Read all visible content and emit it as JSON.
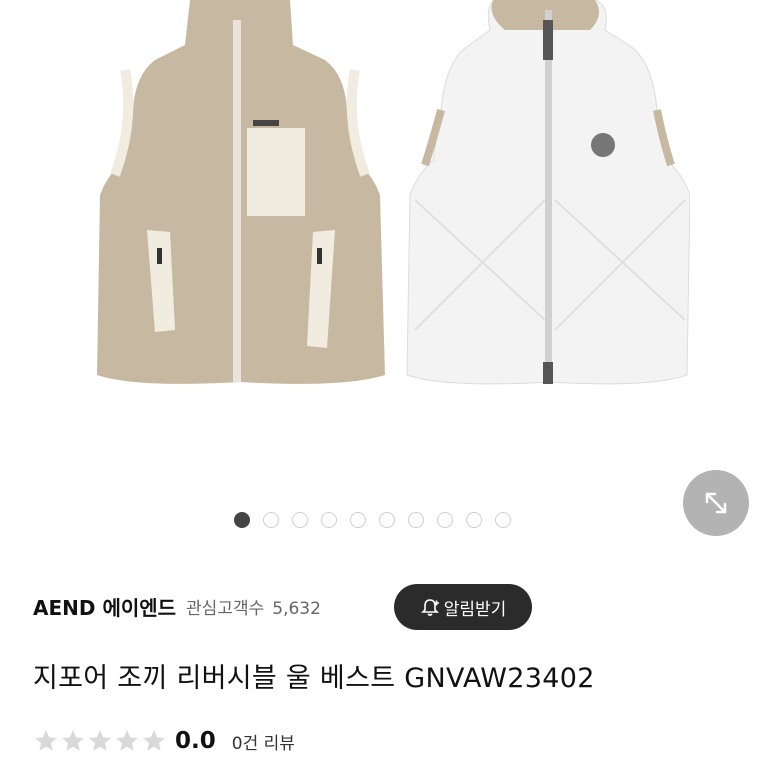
{
  "gallery": {
    "slide_count": 10,
    "active_index": 0
  },
  "product": {
    "brand": "AEND 에이엔드",
    "followers_label": "관심고객수",
    "followers_count": "5,632",
    "alarm_label": "알림받기",
    "title": "지포어 조끼 리버시블 울 베스트 GNVAW23402",
    "rating_score": "0.0",
    "review_label": "0건 리뷰",
    "rating_value": 0
  },
  "colors": {
    "fleece": "#c7b9a1",
    "trim": "#f1ece0",
    "quilted": "#f3f3f3",
    "star_empty": "#d9d9d9",
    "button_dark": "#2b2b2b"
  },
  "icons": {
    "expand": "expand-arrows-icon",
    "bell": "bell-plus-icon",
    "star": "star-icon"
  }
}
